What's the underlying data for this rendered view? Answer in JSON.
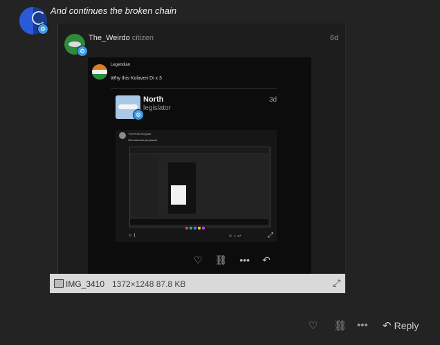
{
  "post": {
    "headline": "And continues the broken chain"
  },
  "quote": {
    "username": "The_Weirdo",
    "user_title": "citizen",
    "age": "6d",
    "screenshot": {
      "username": "Legendian",
      "text": "Why this Kolaveri Di x 3",
      "north": {
        "name": "North",
        "title": "legislator",
        "age": "3d"
      },
      "inner": {
        "username": "TheFRSM",
        "user_role": "Regular",
        "text": "Chromebook jumpscare",
        "reaction_count": "1"
      }
    },
    "attachment": {
      "filename": "IMG_3410",
      "meta": "1372×1248 87.8 KB"
    }
  },
  "actions": {
    "reply_label": "Reply"
  },
  "icons": {
    "heart": "heart-icon",
    "link": "link-icon",
    "more": "more-icon",
    "reply": "reply-icon",
    "expand": "expand-icon",
    "image": "image-icon"
  }
}
